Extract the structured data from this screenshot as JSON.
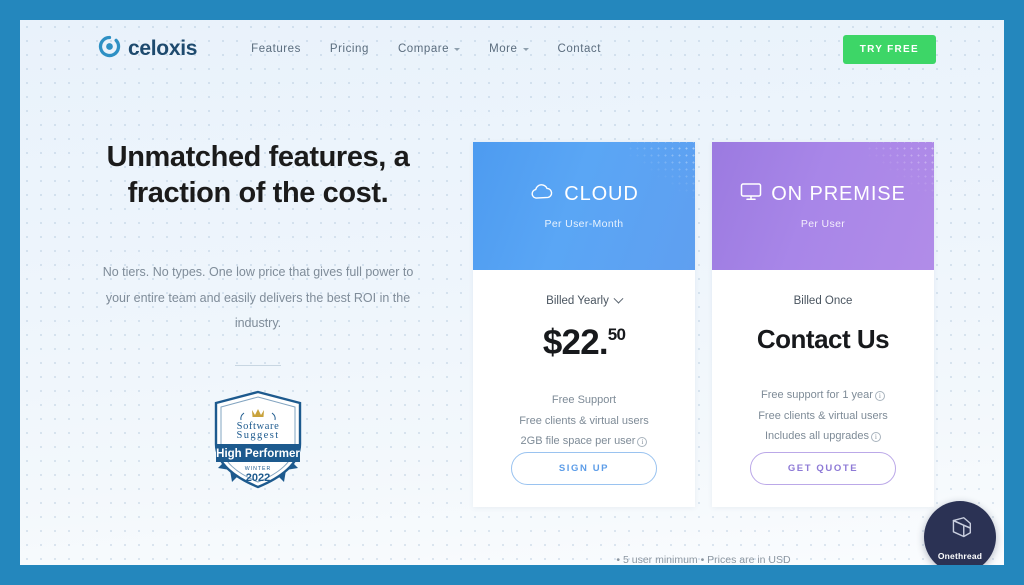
{
  "brand": {
    "logo_text": "celoxis",
    "logo_icon": "celoxis-circle-c-icon",
    "logo_color": "#1e4a6e",
    "logo_mark_color": "#2e90c4"
  },
  "nav": {
    "links": [
      {
        "label": "Features",
        "has_dropdown": false
      },
      {
        "label": "Pricing",
        "has_dropdown": false
      },
      {
        "label": "Compare",
        "has_dropdown": true
      },
      {
        "label": "More",
        "has_dropdown": true
      },
      {
        "label": "Contact",
        "has_dropdown": false
      }
    ],
    "cta_label": "TRY FREE",
    "cta_color": "#3dd667"
  },
  "hero": {
    "headline": "Unmatched features, a fraction of the cost.",
    "body": "No tiers. No types. One low price that gives full power to your entire team and easily delivers the best ROI in the industry."
  },
  "award_badge": {
    "brand_line1": "Software",
    "brand_line2": "Suggest",
    "registered_mark": "®",
    "title": "High Performer",
    "season": "WINTER",
    "year": "2022",
    "color": "#1d5a8e"
  },
  "pricing": {
    "cards": [
      {
        "id": "cloud",
        "icon": "cloud-icon",
        "title": "CLOUD",
        "subtitle": "Per User-Month",
        "header_color": "#5aa6f5",
        "billing_label": "Billed Yearly",
        "billing_is_dropdown": true,
        "price_main": "$22.",
        "price_cents": "50",
        "features": [
          {
            "text": "Free Support",
            "info": false
          },
          {
            "text": "Free clients & virtual users",
            "info": false
          },
          {
            "text": "2GB file space per user",
            "info": true
          }
        ],
        "cta_label": "SIGN UP",
        "cta_color": "#5d9de8"
      },
      {
        "id": "onpremise",
        "icon": "desktop-monitor-icon",
        "title": "ON PREMISE",
        "subtitle": "Per User",
        "header_color": "#a886e8",
        "billing_label": "Billed Once",
        "billing_is_dropdown": false,
        "price_main": "Contact Us",
        "price_cents": "",
        "features": [
          {
            "text": "Free support for 1 year",
            "info": true
          },
          {
            "text": "Free clients & virtual users",
            "info": false
          },
          {
            "text": "Includes all upgrades",
            "info": true
          }
        ],
        "cta_label": "GET QUOTE",
        "cta_color": "#8d79d6"
      }
    ],
    "footnote": "• 5 user minimum • Prices are in USD"
  },
  "widget": {
    "label": "Onethread",
    "icon": "onethread-cube-icon",
    "color": "#2b3254"
  }
}
